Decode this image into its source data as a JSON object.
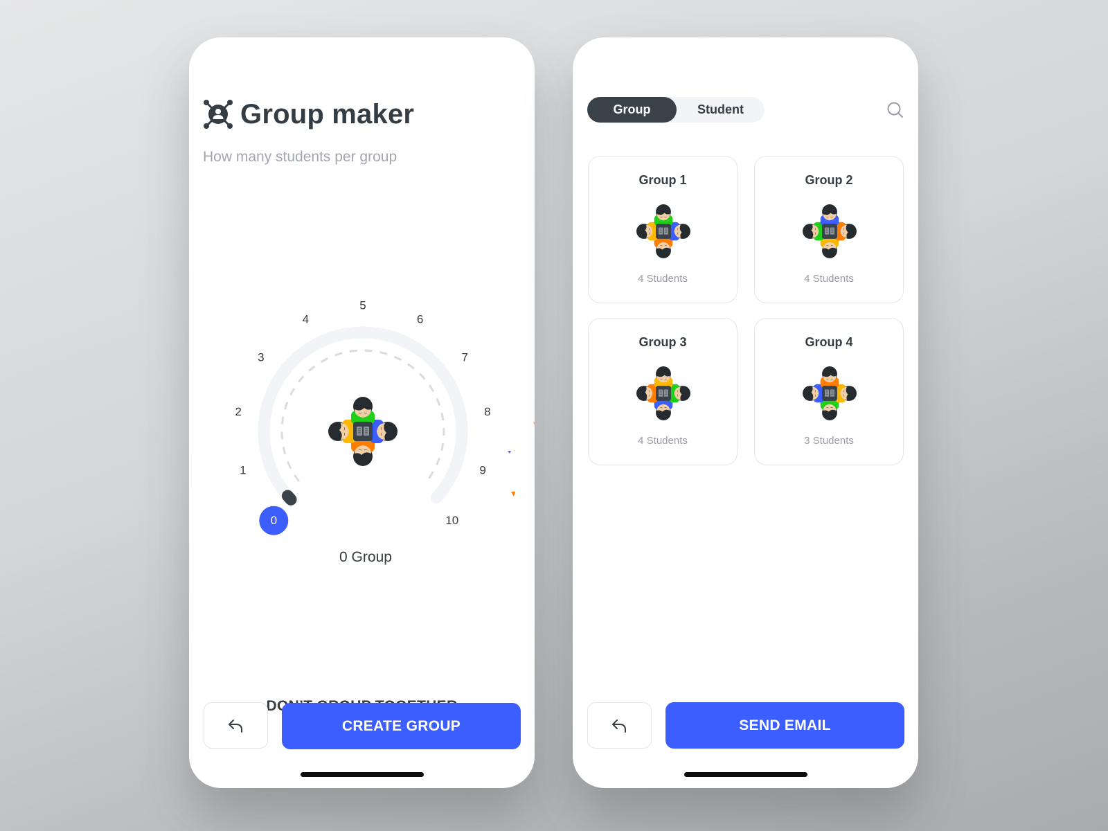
{
  "colors": {
    "accent": "#3d5efe",
    "dark": "#3a4249",
    "green": "#1fcf1a",
    "blue": "#3d5efe",
    "yellow": "#ffb800",
    "orange": "#ff7d00",
    "track": "#f3f4f8",
    "muted": "#a3a5b1"
  },
  "left_screen": {
    "title": "Group maker",
    "logo_icon": "group-network-icon",
    "subtitle": "How many students per group",
    "dial": {
      "ticks": [
        "0",
        "1",
        "2",
        "3",
        "4",
        "5",
        "6",
        "7",
        "8",
        "9",
        "10"
      ],
      "selected_value": "0",
      "min": 0,
      "max": 10,
      "group_count_label": "0 Group"
    },
    "dont_group_label": "DON’T GROUP TOGETHER",
    "back_icon": "reply-arrow-icon",
    "primary_button_label": "CREATE GROUP"
  },
  "right_screen": {
    "tabs": [
      {
        "label": "Group",
        "active": true
      },
      {
        "label": "Student",
        "active": false
      }
    ],
    "search_icon": "search-icon",
    "groups": [
      {
        "title": "Group 1",
        "count_label": "4 Students",
        "seats": {
          "top": "green",
          "left": "yellow",
          "right": "blue",
          "bottom": "orange"
        }
      },
      {
        "title": "Group 2",
        "count_label": "4 Students",
        "seats": {
          "top": "blue",
          "left": "green",
          "right": "orange",
          "bottom": "yellow"
        }
      },
      {
        "title": "Group 3",
        "count_label": "4 Students",
        "seats": {
          "top": "yellow",
          "left": "orange",
          "right": "green",
          "bottom": "blue"
        }
      },
      {
        "title": "Group 4",
        "count_label": "3 Students",
        "seats": {
          "top": "orange",
          "left": "blue",
          "right": "yellow",
          "bottom": "green"
        }
      }
    ],
    "back_icon": "reply-arrow-icon",
    "primary_button_label": "SEND EMAIL"
  }
}
